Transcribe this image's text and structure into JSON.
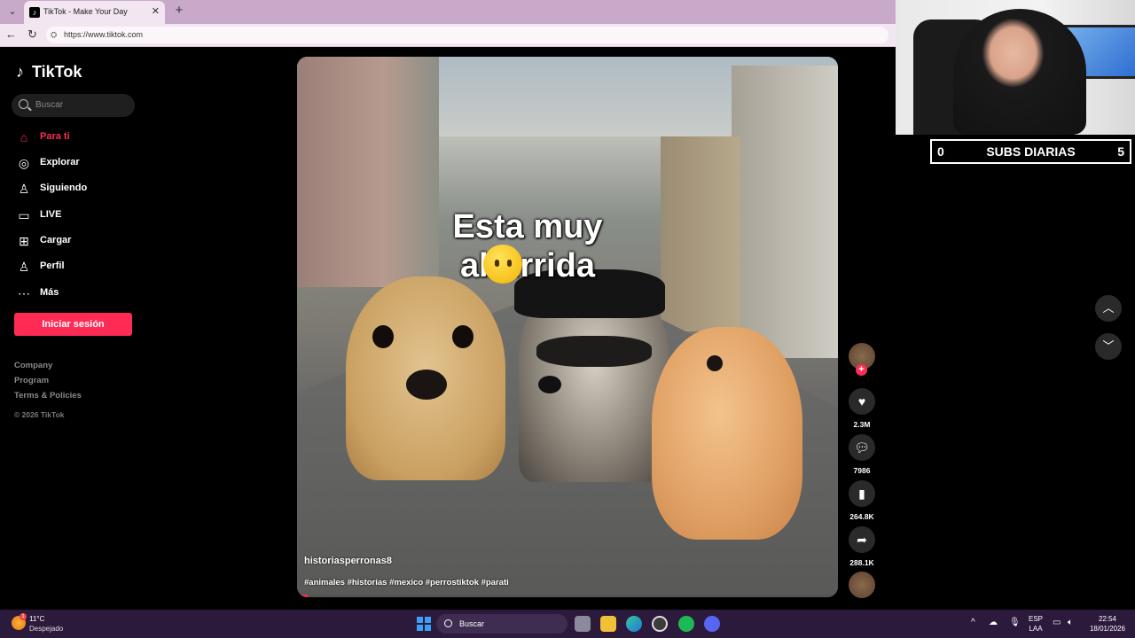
{
  "browser": {
    "tab_title": "TikTok - Make Your Day",
    "url": "https://www.tiktok.com"
  },
  "sidebar": {
    "logo": "TikTok",
    "search_placeholder": "Buscar",
    "items": [
      {
        "label": "Para ti",
        "icon": "home-icon"
      },
      {
        "label": "Explorar",
        "icon": "compass-icon"
      },
      {
        "label": "Siguiendo",
        "icon": "following-icon"
      },
      {
        "label": "LIVE",
        "icon": "live-icon"
      },
      {
        "label": "Cargar",
        "icon": "upload-icon"
      },
      {
        "label": "Perfil",
        "icon": "profile-icon"
      },
      {
        "label": "Más",
        "icon": "more-icon"
      }
    ],
    "login_label": "Iniciar sesión",
    "footer": [
      "Company",
      "Program",
      "Terms & Policies"
    ],
    "copyright": "© 2026 TikTok"
  },
  "video": {
    "caption_line1": "Esta muy",
    "caption_line2": "aburrida",
    "username": "historiasperronas8",
    "hashtags": "#animales #historias #mexico #perrostiktok #parati"
  },
  "actions": {
    "likes": "2.3M",
    "comments": "7986",
    "saves": "264.8K",
    "shares": "288.1K"
  },
  "overlay": {
    "subs_left": "0",
    "subs_title": "SUBS DIARIAS",
    "subs_right": "5"
  },
  "taskbar": {
    "temperature": "11°C",
    "weather": "Despejado",
    "search_placeholder": "Buscar",
    "lang1": "ESP",
    "lang2": "LAA",
    "time": "22:54",
    "date": "18/01/2026"
  }
}
